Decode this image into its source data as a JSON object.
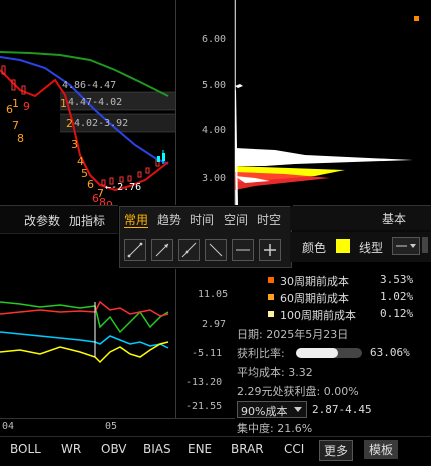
{
  "main_chart": {
    "price_axis": [
      "6.00",
      "5.00",
      "4.00",
      "3.00"
    ],
    "annotations": {
      "range_top": "4.86-4.47",
      "range_mid": "4.47-4.02",
      "range_low": "4.02-3.92",
      "low_price": "2.76",
      "low_arrow": "←"
    },
    "seq_numbers": {
      "a6": "6",
      "a1": "1",
      "a9": "9",
      "a7": "7",
      "a8": "8",
      "b1": "1",
      "b2": "2",
      "b3": "3",
      "b4": "4",
      "b5": "5",
      "b6": "6",
      "b7": "7",
      "b8": "8",
      "b9": "9",
      "b6b": "6"
    }
  },
  "control_bar": {
    "params": "改参数",
    "add_indicator": "加指标"
  },
  "drawing_popup": {
    "tabs": [
      "常用",
      "趋势",
      "时间",
      "空间",
      "时空"
    ],
    "active_tab": "常用",
    "tools": [
      "line-segment-icon",
      "ray-icon",
      "extended-line-icon",
      "down-line-icon",
      "horizontal-line-icon",
      "plus-icon"
    ]
  },
  "right_panel": {
    "title": "基本",
    "color_label": "颜色",
    "color_value": "#ffff00",
    "line_label": "线型"
  },
  "indicator": {
    "axis": [
      "11.05",
      "2.97",
      "-5.11",
      "-13.20",
      "-21.55"
    ],
    "date_left": "04",
    "date_mid": "05"
  },
  "chip_cost": {
    "rows": [
      {
        "label": "30周期前成本",
        "value": "3.53%",
        "color": "#ff6600"
      },
      {
        "label": "60周期前成本",
        "value": "1.02%",
        "color": "#ffa020"
      },
      {
        "label": "100周期前成本",
        "value": "0.12%",
        "color": "#fff0a0"
      }
    ],
    "date_label": "日期",
    "date_value": "2025年5月23日",
    "profit_ratio_label": "获利比率",
    "profit_ratio": 0.6306,
    "profit_ratio_value": "63.06%",
    "avg_cost_label": "平均成本",
    "avg_cost_value": "3.32",
    "profit_at_label": "2.29元处获利盘",
    "profit_at_value": "0.00%",
    "cost_select": "90%成本",
    "cost_range": "2.87-4.45",
    "concentration_label": "集中度",
    "concentration_value": "21.6%"
  },
  "bottom_tabs": [
    "BOLL",
    "WR",
    "OBV",
    "BIAS",
    "ENE",
    "BRAR",
    "CCI",
    "更多",
    "模板"
  ]
}
